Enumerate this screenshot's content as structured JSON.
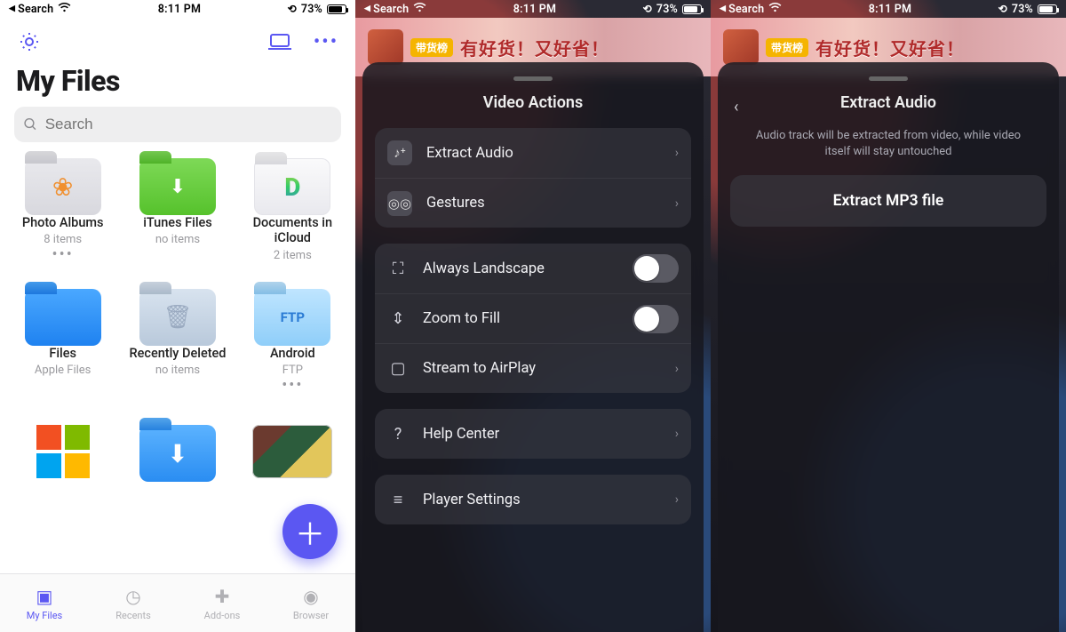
{
  "status": {
    "back_label": "Search",
    "time": "8:11 PM",
    "battery_pct": "73%"
  },
  "pane1": {
    "title": "My Files",
    "search_placeholder": "Search",
    "items": [
      {
        "name": "Photo Albums",
        "sub": "8 items",
        "style": "folder-gray",
        "glyph": "❀",
        "dots": true
      },
      {
        "name": "iTunes Files",
        "sub": "no items",
        "style": "folder-green",
        "glyph": "⇣",
        "dots": false
      },
      {
        "name": "Documents in iCloud",
        "sub": "2 items",
        "style": "folder-white",
        "glyph": "D",
        "dots": false
      },
      {
        "name": "Files",
        "sub": "Apple Files",
        "style": "folder-blue",
        "glyph": "",
        "dots": false
      },
      {
        "name": "Recently Deleted",
        "sub": "no items",
        "style": "folder-bluegray",
        "glyph": "🗑",
        "dots": false
      },
      {
        "name": "Android",
        "sub": "FTP",
        "style": "folder-lightblue",
        "glyph": "FTP",
        "dots": true
      }
    ],
    "tabs": [
      {
        "label": "My Files",
        "active": true
      },
      {
        "label": "Recents",
        "active": false
      },
      {
        "label": "Add-ons",
        "active": false
      },
      {
        "label": "Browser",
        "active": false
      }
    ]
  },
  "pane2": {
    "banner_pill": "带货榜",
    "banner_text": "有好货！又好省！",
    "title": "Video Actions",
    "group1": [
      {
        "label": "Extract Audio"
      },
      {
        "label": "Gestures"
      }
    ],
    "group2": [
      {
        "label": "Always Landscape",
        "toggle": true,
        "on": false
      },
      {
        "label": "Zoom to Fill",
        "toggle": true,
        "on": false
      },
      {
        "label": "Stream to AirPlay",
        "toggle": false
      }
    ],
    "group3": [
      {
        "label": "Help Center"
      }
    ],
    "group4": [
      {
        "label": "Player Settings"
      }
    ]
  },
  "pane3": {
    "title": "Extract Audio",
    "desc": "Audio track will be extracted from video, while video itself will stay untouched",
    "button": "Extract MP3 file"
  }
}
